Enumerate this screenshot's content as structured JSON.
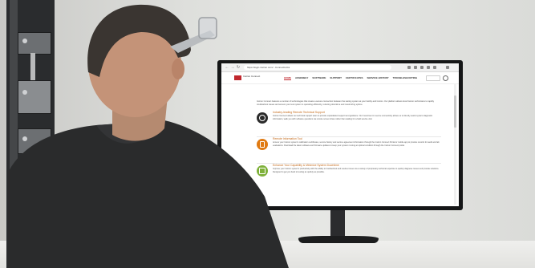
{
  "browser": {
    "url": "https://login.instron.com/...ConnectLinks",
    "back_glyph": "←",
    "forward_glyph": "→",
    "reload_glyph": "↻"
  },
  "site": {
    "brand_lines": "Instron Connect",
    "nav": [
      {
        "label": "HOME",
        "active": true
      },
      {
        "label": "ASSEMBLY",
        "active": false
      },
      {
        "label": "SOFTWARE",
        "active": false
      },
      {
        "label": "SUPPORT",
        "active": false
      },
      {
        "label": "CERTIFICATES",
        "active": false
      },
      {
        "label": "SERVICE HISTORY",
        "active": false
      },
      {
        "label": "TROUBLESHOOTING",
        "active": false
      }
    ],
    "accent_color": "#c0272d"
  },
  "content": {
    "intro": "Instron Connect features a number of technologies that create a secure connection between the testing system at your facility and Instron. Our platform allows local Instron technicians to rapidly troubleshoot issues and ensure your test system is operating efficiently, reducing downtime and maximizing uptime.",
    "features": [
      {
        "title": "Industry-leading Remote Technical Support",
        "text": "Instron Connect allows our technical support team to provide unparalleled support and guidance. Our investment in secure connectivity allows us to directly assist system diagnostic information, walk you with software questions via remote screen share rather than waiting for a field service visit.",
        "icon": "remote-support-icon",
        "color": "#2b2b2b"
      },
      {
        "title": "Remote Information Tool",
        "text": "Access your Instron system's calibration certificates, service history and service agreement information through the Instron Connect Portal or mobile app to provide records for audit and lab evaluations. Download the latest software and firmware updates to keep your system running at optimal condition through the Instron Connect portal.",
        "icon": "mobile-phone-icon",
        "color": "#e07a12"
      },
      {
        "title": "Enhance Your Capability & Minimize System Downtime",
        "text": "Improve your Instron system's productivity with the ability to troubleshoot and resolve issues via a variety of proprietary technical expertise to quickly diagnose issues and provide solutions. Designed to get you back to testing as quickly as possible.",
        "icon": "checklist-icon",
        "color": "#7fb13a"
      }
    ]
  }
}
